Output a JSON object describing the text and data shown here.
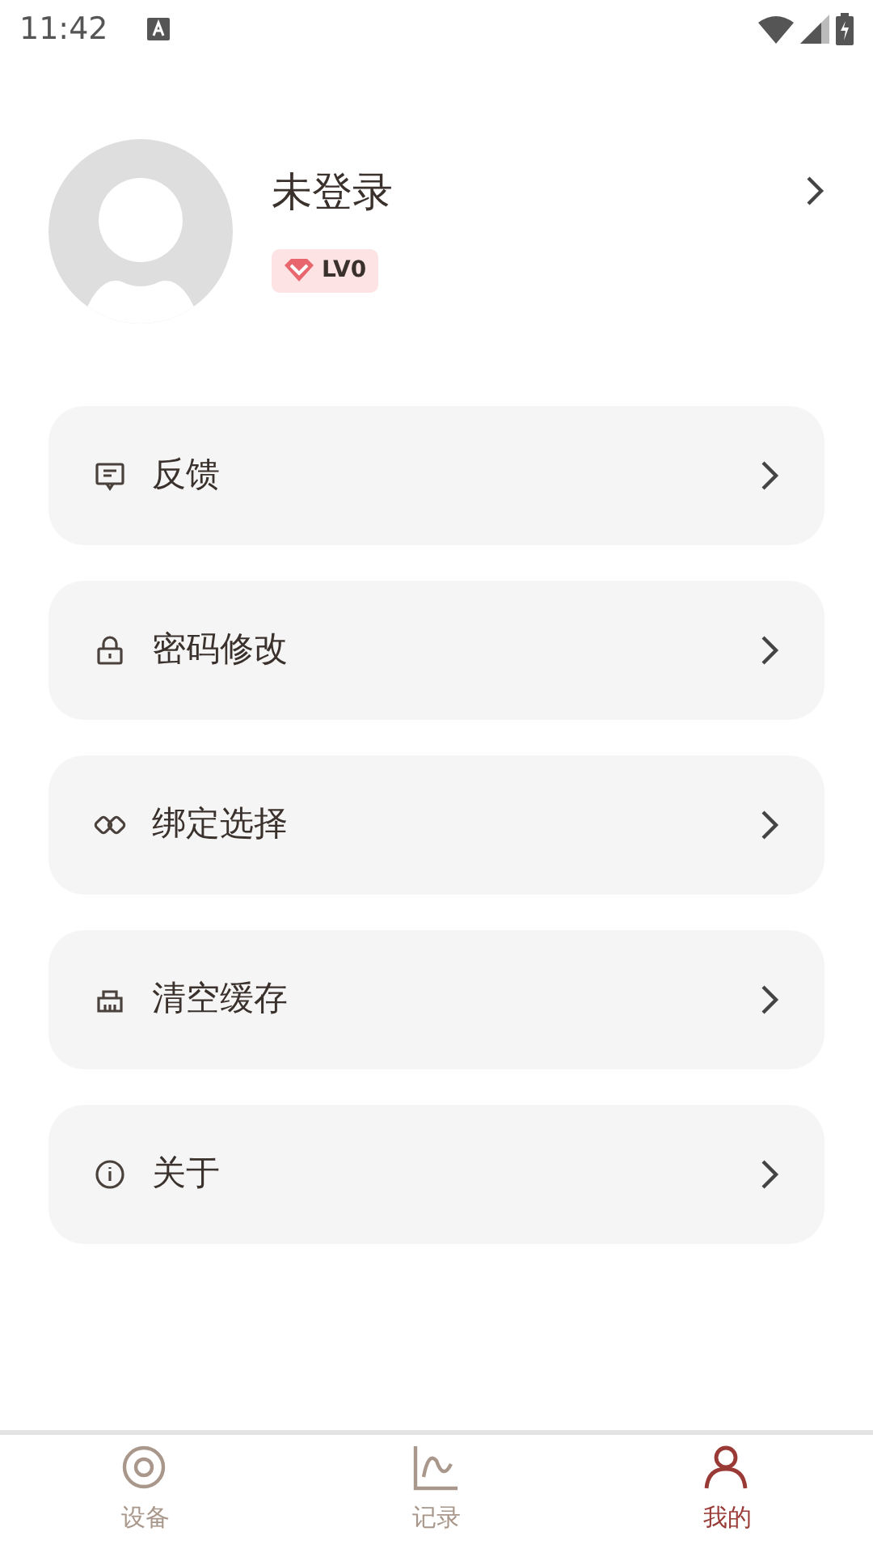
{
  "status_bar": {
    "time": "11:42"
  },
  "profile": {
    "name": "未登录",
    "level_badge": "LV0"
  },
  "menu": [
    {
      "label": "反馈",
      "kind": "feedback"
    },
    {
      "label": "密码修改",
      "kind": "lock"
    },
    {
      "label": "绑定选择",
      "kind": "link"
    },
    {
      "label": "清空缓存",
      "kind": "clear"
    },
    {
      "label": "关于",
      "kind": "info"
    }
  ],
  "tabs": [
    {
      "label": "设备",
      "kind": "device",
      "selected": false
    },
    {
      "label": "记录",
      "kind": "chart",
      "selected": false
    },
    {
      "label": "我的",
      "kind": "person",
      "selected": true
    }
  ]
}
